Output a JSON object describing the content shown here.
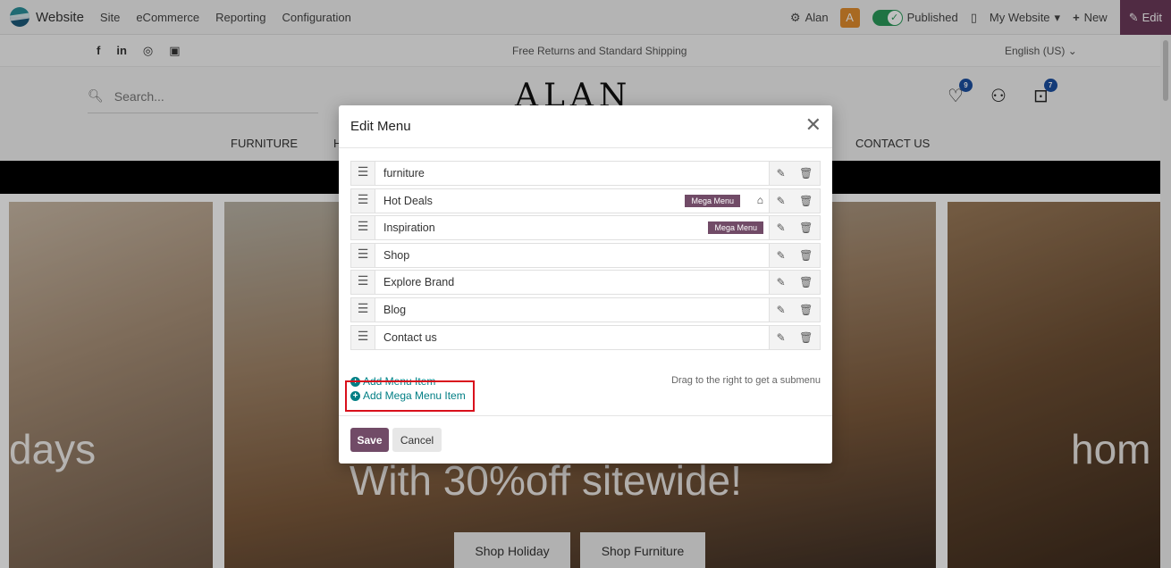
{
  "topbar": {
    "app_name": "Website",
    "menu": [
      "Site",
      "eCommerce",
      "Reporting",
      "Configuration"
    ],
    "user": "Alan",
    "avatar_letter": "A",
    "published": "Published",
    "website_select": "My Website",
    "new_label": "New",
    "edit_label": "Edit"
  },
  "site_bar": {
    "social": [
      "f",
      "in",
      "◎",
      "▣"
    ],
    "promo": "Free Returns and Standard Shipping",
    "language": "English (US)"
  },
  "header": {
    "search_placeholder": "Search...",
    "brand": "ALAN",
    "wishlist_count": "9",
    "cart_count": "7",
    "nav": [
      "FURNITURE",
      "H",
      "CONTACT US"
    ]
  },
  "hero": {
    "left_text": "days",
    "center_text": "With 30%off sitewide!",
    "right_text": "hom",
    "buttons": [
      "Shop Holiday",
      "Shop Furniture"
    ]
  },
  "modal": {
    "title": "Edit Menu",
    "items": [
      {
        "label": "furniture",
        "mega": "",
        "home": false
      },
      {
        "label": "Hot Deals",
        "mega": "Mega Menu",
        "home": true
      },
      {
        "label": "Inspiration",
        "mega": "Mega Menu",
        "home": false
      },
      {
        "label": "Shop",
        "mega": "",
        "home": false
      },
      {
        "label": "Explore Brand",
        "mega": "",
        "home": false
      },
      {
        "label": "Blog",
        "mega": "",
        "home": false
      },
      {
        "label": "Contact us",
        "mega": "",
        "home": false
      }
    ],
    "add_menu_item": "Add Menu Item",
    "add_mega_menu_item": "Add Mega Menu Item",
    "hint": "Drag to the right to get a submenu",
    "save": "Save",
    "cancel": "Cancel"
  },
  "colors": {
    "accent": "#714b67",
    "link": "#017e84",
    "highlight": "#d9101c"
  }
}
